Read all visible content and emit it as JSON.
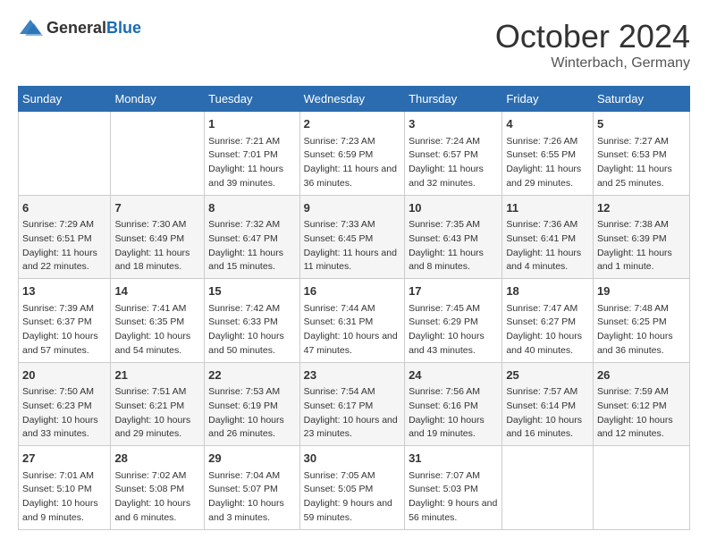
{
  "header": {
    "logo_general": "General",
    "logo_blue": "Blue",
    "month": "October 2024",
    "location": "Winterbach, Germany"
  },
  "columns": [
    "Sunday",
    "Monday",
    "Tuesday",
    "Wednesday",
    "Thursday",
    "Friday",
    "Saturday"
  ],
  "weeks": [
    [
      {
        "day": "",
        "info": ""
      },
      {
        "day": "",
        "info": ""
      },
      {
        "day": "1",
        "info": "Sunrise: 7:21 AM\nSunset: 7:01 PM\nDaylight: 11 hours and 39 minutes."
      },
      {
        "day": "2",
        "info": "Sunrise: 7:23 AM\nSunset: 6:59 PM\nDaylight: 11 hours and 36 minutes."
      },
      {
        "day": "3",
        "info": "Sunrise: 7:24 AM\nSunset: 6:57 PM\nDaylight: 11 hours and 32 minutes."
      },
      {
        "day": "4",
        "info": "Sunrise: 7:26 AM\nSunset: 6:55 PM\nDaylight: 11 hours and 29 minutes."
      },
      {
        "day": "5",
        "info": "Sunrise: 7:27 AM\nSunset: 6:53 PM\nDaylight: 11 hours and 25 minutes."
      }
    ],
    [
      {
        "day": "6",
        "info": "Sunrise: 7:29 AM\nSunset: 6:51 PM\nDaylight: 11 hours and 22 minutes."
      },
      {
        "day": "7",
        "info": "Sunrise: 7:30 AM\nSunset: 6:49 PM\nDaylight: 11 hours and 18 minutes."
      },
      {
        "day": "8",
        "info": "Sunrise: 7:32 AM\nSunset: 6:47 PM\nDaylight: 11 hours and 15 minutes."
      },
      {
        "day": "9",
        "info": "Sunrise: 7:33 AM\nSunset: 6:45 PM\nDaylight: 11 hours and 11 minutes."
      },
      {
        "day": "10",
        "info": "Sunrise: 7:35 AM\nSunset: 6:43 PM\nDaylight: 11 hours and 8 minutes."
      },
      {
        "day": "11",
        "info": "Sunrise: 7:36 AM\nSunset: 6:41 PM\nDaylight: 11 hours and 4 minutes."
      },
      {
        "day": "12",
        "info": "Sunrise: 7:38 AM\nSunset: 6:39 PM\nDaylight: 11 hours and 1 minute."
      }
    ],
    [
      {
        "day": "13",
        "info": "Sunrise: 7:39 AM\nSunset: 6:37 PM\nDaylight: 10 hours and 57 minutes."
      },
      {
        "day": "14",
        "info": "Sunrise: 7:41 AM\nSunset: 6:35 PM\nDaylight: 10 hours and 54 minutes."
      },
      {
        "day": "15",
        "info": "Sunrise: 7:42 AM\nSunset: 6:33 PM\nDaylight: 10 hours and 50 minutes."
      },
      {
        "day": "16",
        "info": "Sunrise: 7:44 AM\nSunset: 6:31 PM\nDaylight: 10 hours and 47 minutes."
      },
      {
        "day": "17",
        "info": "Sunrise: 7:45 AM\nSunset: 6:29 PM\nDaylight: 10 hours and 43 minutes."
      },
      {
        "day": "18",
        "info": "Sunrise: 7:47 AM\nSunset: 6:27 PM\nDaylight: 10 hours and 40 minutes."
      },
      {
        "day": "19",
        "info": "Sunrise: 7:48 AM\nSunset: 6:25 PM\nDaylight: 10 hours and 36 minutes."
      }
    ],
    [
      {
        "day": "20",
        "info": "Sunrise: 7:50 AM\nSunset: 6:23 PM\nDaylight: 10 hours and 33 minutes."
      },
      {
        "day": "21",
        "info": "Sunrise: 7:51 AM\nSunset: 6:21 PM\nDaylight: 10 hours and 29 minutes."
      },
      {
        "day": "22",
        "info": "Sunrise: 7:53 AM\nSunset: 6:19 PM\nDaylight: 10 hours and 26 minutes."
      },
      {
        "day": "23",
        "info": "Sunrise: 7:54 AM\nSunset: 6:17 PM\nDaylight: 10 hours and 23 minutes."
      },
      {
        "day": "24",
        "info": "Sunrise: 7:56 AM\nSunset: 6:16 PM\nDaylight: 10 hours and 19 minutes."
      },
      {
        "day": "25",
        "info": "Sunrise: 7:57 AM\nSunset: 6:14 PM\nDaylight: 10 hours and 16 minutes."
      },
      {
        "day": "26",
        "info": "Sunrise: 7:59 AM\nSunset: 6:12 PM\nDaylight: 10 hours and 12 minutes."
      }
    ],
    [
      {
        "day": "27",
        "info": "Sunrise: 7:01 AM\nSunset: 5:10 PM\nDaylight: 10 hours and 9 minutes."
      },
      {
        "day": "28",
        "info": "Sunrise: 7:02 AM\nSunset: 5:08 PM\nDaylight: 10 hours and 6 minutes."
      },
      {
        "day": "29",
        "info": "Sunrise: 7:04 AM\nSunset: 5:07 PM\nDaylight: 10 hours and 3 minutes."
      },
      {
        "day": "30",
        "info": "Sunrise: 7:05 AM\nSunset: 5:05 PM\nDaylight: 9 hours and 59 minutes."
      },
      {
        "day": "31",
        "info": "Sunrise: 7:07 AM\nSunset: 5:03 PM\nDaylight: 9 hours and 56 minutes."
      },
      {
        "day": "",
        "info": ""
      },
      {
        "day": "",
        "info": ""
      }
    ]
  ]
}
